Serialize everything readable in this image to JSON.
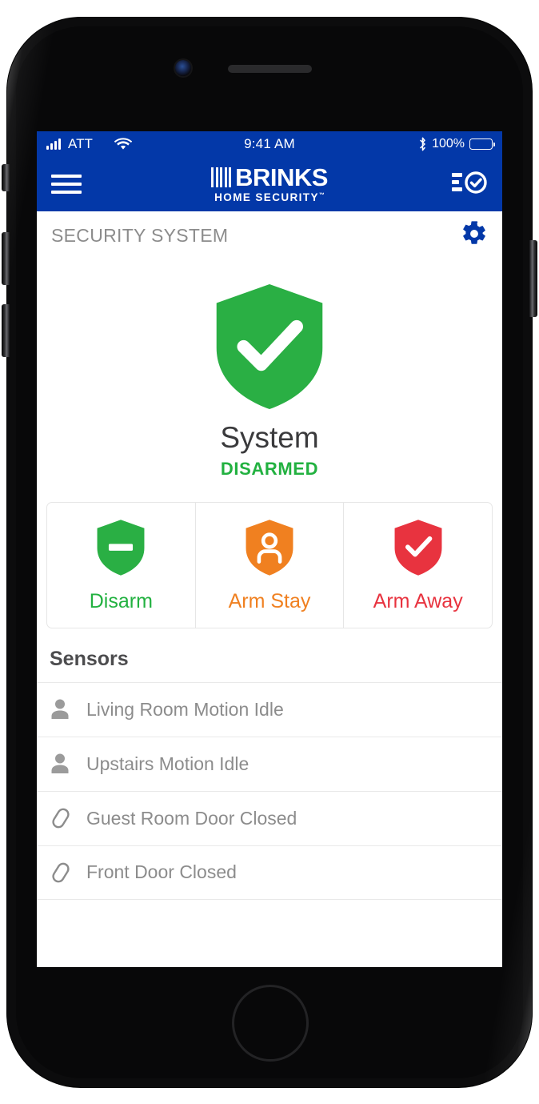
{
  "status_bar": {
    "carrier": "ATT",
    "signal_icon": "cellular-signal-icon",
    "wifi_icon": "wifi-icon",
    "time": "9:41 AM",
    "bluetooth_icon": "bluetooth-icon",
    "battery_percent": "100%",
    "battery_icon": "battery-full-icon"
  },
  "app_bar": {
    "menu_icon": "hamburger-menu-icon",
    "brand_name": "BRINKS",
    "brand_subtitle": "HOME SECURITY",
    "brand_trademark": "™",
    "action_icon": "checklist-icon"
  },
  "section": {
    "title": "SECURITY SYSTEM",
    "settings_icon": "gear-icon"
  },
  "hero": {
    "shield_icon": "shield-check-icon",
    "label": "System",
    "status": "DISARMED",
    "status_color": "#22b140",
    "shield_color": "#2aaf44"
  },
  "actions": [
    {
      "id": "disarm",
      "label": "Disarm",
      "icon": "shield-minus-icon",
      "color": "#22b140"
    },
    {
      "id": "arm-stay",
      "label": "Arm Stay",
      "icon": "shield-person-icon",
      "color": "#f08020"
    },
    {
      "id": "arm-away",
      "label": "Arm Away",
      "icon": "shield-check-icon",
      "color": "#e8333f"
    }
  ],
  "sensors": {
    "heading": "Sensors",
    "items": [
      {
        "label": "Living Room Motion Idle",
        "icon": "motion-person-icon"
      },
      {
        "label": "Upstairs Motion Idle",
        "icon": "motion-person-icon"
      },
      {
        "label": "Guest Room Door Closed",
        "icon": "door-contact-icon"
      },
      {
        "label": "Front Door Closed",
        "icon": "door-contact-icon"
      }
    ]
  },
  "theme": {
    "brand_blue": "#0338a8",
    "green": "#22b140",
    "orange": "#f08020",
    "red": "#e8333f",
    "gray_text": "#8c8c8c"
  }
}
